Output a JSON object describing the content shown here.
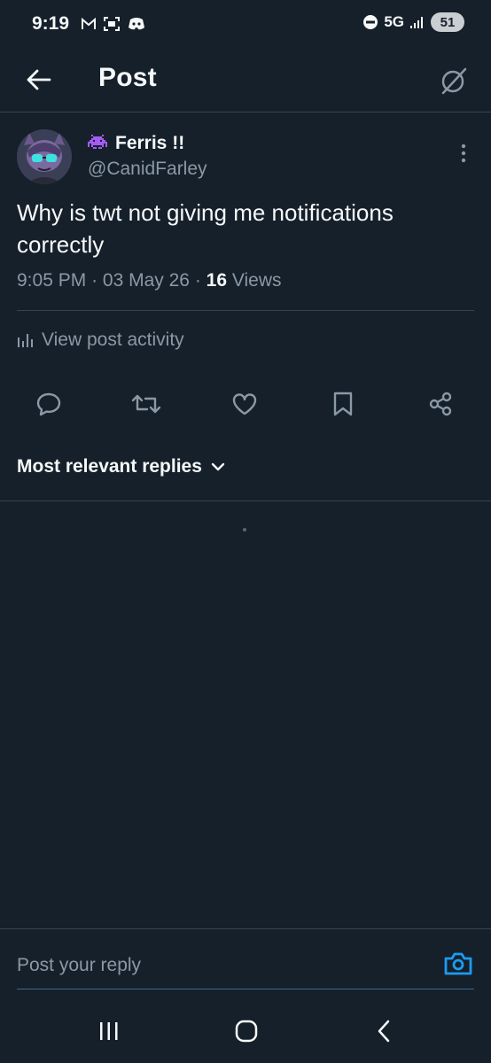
{
  "status_bar": {
    "time": "9:19",
    "network": "5G",
    "battery": "51",
    "icons": [
      "gmail-icon",
      "screenshot-icon",
      "discord-icon",
      "dnd-icon",
      "signal-icon"
    ]
  },
  "header": {
    "title": "Post",
    "back_icon": "arrow-left-icon",
    "grok_icon": "grok-icon"
  },
  "post": {
    "display_name": "Ferris !!",
    "name_emoji": "space-invader-icon",
    "handle": "@CanidFarley",
    "text": "Why is twt not giving me notifications correctly",
    "time": "9:05 PM",
    "separator": "·",
    "date": "03 May 26",
    "views_count": "16",
    "views_label": "Views"
  },
  "activity": {
    "label": "View post activity"
  },
  "actions": [
    "reply-icon",
    "repost-icon",
    "like-icon",
    "bookmark-icon",
    "share-icon"
  ],
  "replies": {
    "sort_label": "Most relevant replies"
  },
  "composer": {
    "placeholder": "Post your reply"
  },
  "colors": {
    "background": "#15202b",
    "accent": "#1d9bf0",
    "secondary_text": "#8b98a5",
    "divider": "#38444d"
  }
}
